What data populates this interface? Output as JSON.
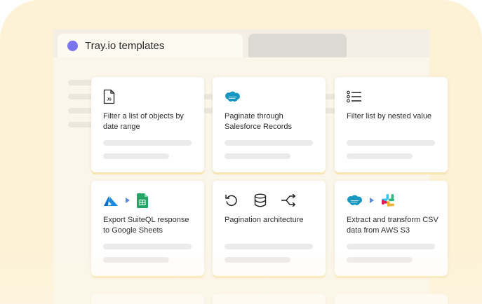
{
  "colors": {
    "accent": "#7a74ef",
    "card_shadow": "#f7e5b3",
    "backdrop": "#fdf2d6"
  },
  "tab": {
    "title": "Tray.io templates"
  },
  "cards": [
    {
      "title": "Filter a list of objects by date range",
      "icons": [
        "javascript-file-icon"
      ]
    },
    {
      "title": "Paginate through Salesforce Records",
      "icons": [
        "salesforce-icon"
      ]
    },
    {
      "title": "Filter list by nested value",
      "icons": [
        "list-icon"
      ]
    },
    {
      "title": "Export SuiteQL response to Google Sheets",
      "icons": [
        "azure-icon",
        "arrow-right-icon",
        "google-sheets-icon"
      ]
    },
    {
      "title": "Pagination architecture",
      "icons": [
        "loop-icon",
        "database-icon",
        "branch-icon"
      ]
    },
    {
      "title": "Extract and transform CSV data from AWS S3",
      "icons": [
        "salesforce-icon",
        "arrow-right-icon",
        "slack-icon"
      ]
    }
  ]
}
